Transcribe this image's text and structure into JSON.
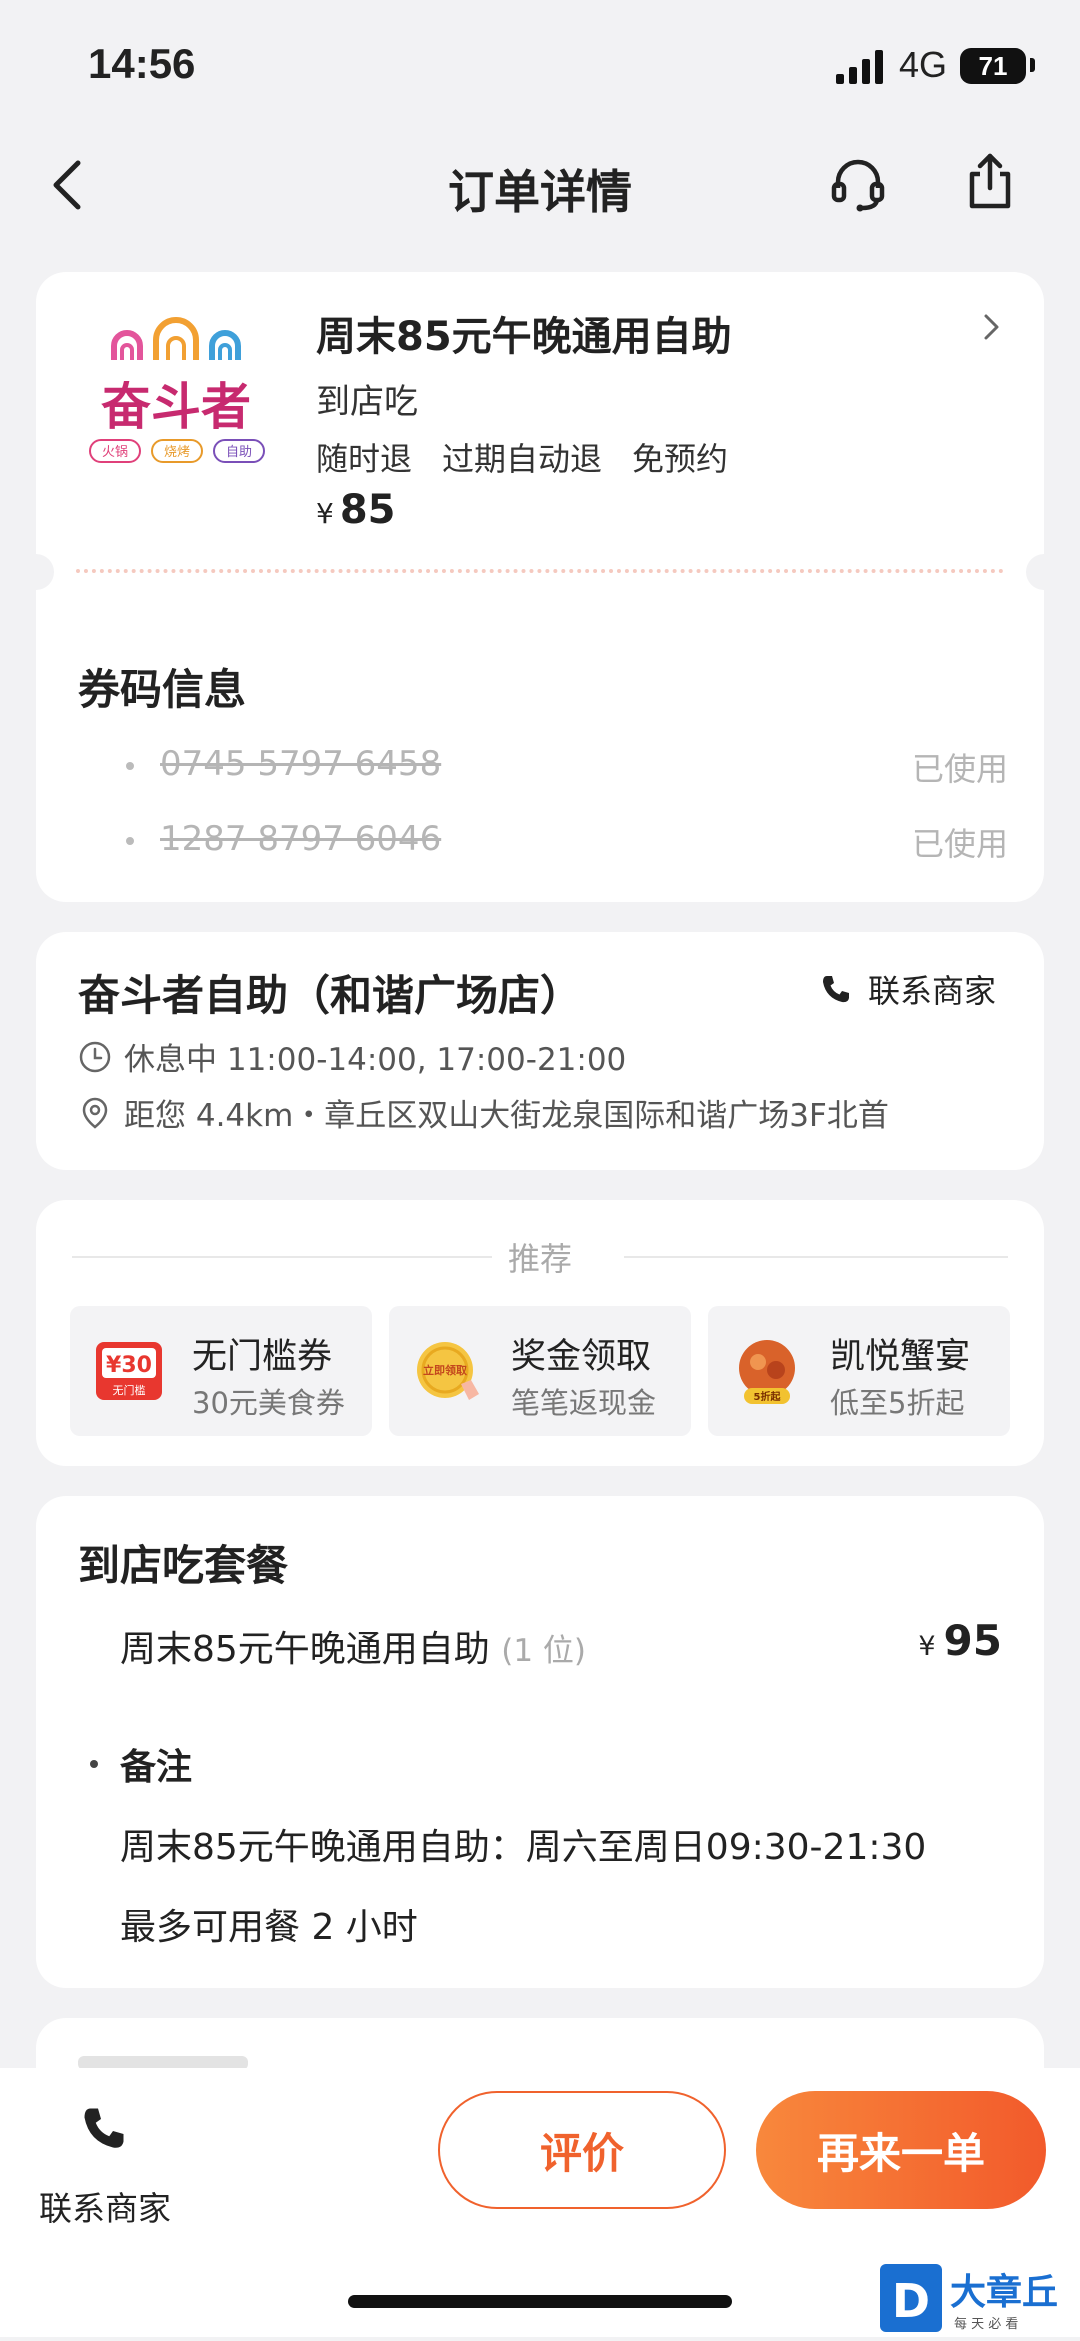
{
  "status": {
    "time": "14:56",
    "network": "4G",
    "battery": "71"
  },
  "nav": {
    "title": "订单详情"
  },
  "deal": {
    "title": "周末85元午晚通用自助",
    "type": "到店吃",
    "tags": [
      "随时退",
      "过期自动退",
      "免预约"
    ],
    "price_symbol": "¥",
    "price": "85",
    "logo": {
      "name": "奋斗者",
      "badges": [
        "火锅",
        "烧烤",
        "自助"
      ]
    }
  },
  "coupons": {
    "title": "券码信息",
    "items": [
      {
        "code": "0745 5797 6458",
        "status": "已使用"
      },
      {
        "code": "1287 8797 6046",
        "status": "已使用"
      }
    ]
  },
  "shop": {
    "name": "奋斗者自助（和谐广场店）",
    "contact_label": "联系商家",
    "hours": "休息中 11:00-14:00, 17:00-21:00",
    "address": "距您 4.4km・章丘区双山大街龙泉国际和谐广场3F北首"
  },
  "recommend": {
    "title": "推荐",
    "items": [
      {
        "title": "无门槛券",
        "subtitle": "30元美食券",
        "icon": "coupon-30-icon",
        "icon_text": "¥30",
        "icon_sub": "无门槛"
      },
      {
        "title": "奖金领取",
        "subtitle": "笔笔返现金",
        "icon": "gold-coin-icon",
        "icon_text": "立即领取"
      },
      {
        "title": "凯悦蟹宴",
        "subtitle": "低至5折起",
        "icon": "crab-dish-icon",
        "icon_text": "5折起"
      }
    ]
  },
  "package": {
    "title": "到店吃套餐",
    "item_name": "周末85元午晚通用自助",
    "item_qty": "(1 位)",
    "price_symbol": "¥",
    "price": "95",
    "note_label": "备注",
    "note_lines": [
      "周末85元午晚通用自助：周六至周日09:30-21:30",
      "最多可用餐 2 小时"
    ]
  },
  "bottom": {
    "call_label": "联系商家",
    "review_label": "评价",
    "again_label": "再来一单"
  },
  "watermark": {
    "letter": "D",
    "text": "大章丘",
    "sub": "每 天 必 看"
  },
  "colors": {
    "accent": "#f0622d",
    "gradient_start": "#f8883c",
    "gradient_end": "#f25a2b"
  }
}
